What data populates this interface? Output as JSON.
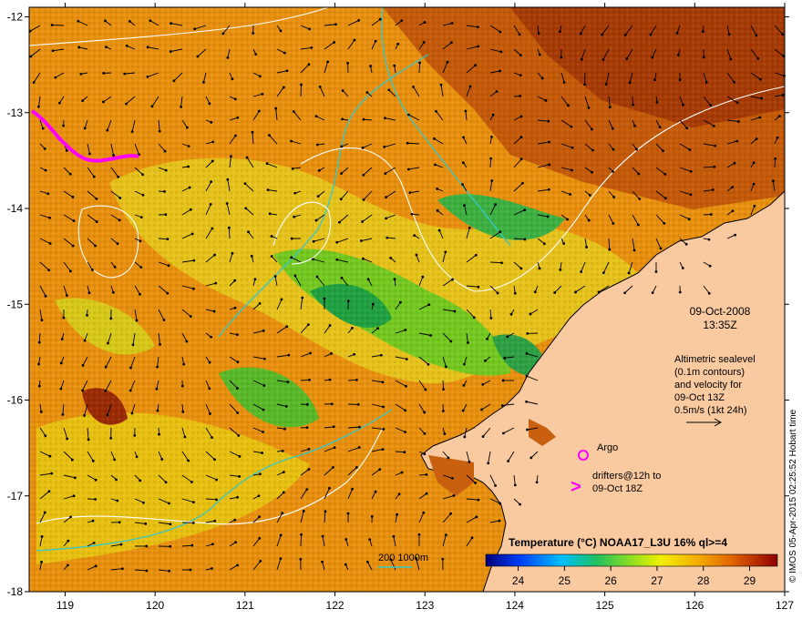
{
  "map": {
    "lon_ticks": [
      "119",
      "120",
      "121",
      "122",
      "123",
      "124",
      "125",
      "126",
      "127"
    ],
    "lat_ticks": [
      "-12",
      "-13",
      "-14",
      "-15",
      "-16",
      "-17",
      "-18"
    ],
    "lon_range": [
      118.6,
      127.0
    ],
    "lat_range": [
      -11.9,
      -18.0
    ]
  },
  "annotations": {
    "date": "09-Oct-2008",
    "time": "13:35Z",
    "alt_line1": "Altimetric sealevel",
    "alt_line2": "(0.1m contours)",
    "alt_line3": "and velocity for",
    "alt_line4": "09-Oct 13Z",
    "alt_line5": "0.5m/s (1kt 24h)",
    "argo_label": "Argo",
    "drifters_line1": "drifters@12h to",
    "drifters_line2": "09-Oct 18Z",
    "drifter_symbol": ">",
    "depth_legend": "200  1000m",
    "credit": "© IMOS 05-Apr-2015 02:25:52 Hobart time"
  },
  "colorbar": {
    "title": "Temperature (°C) NOAA17_L3U 16% ql>=4",
    "ticks": [
      "24",
      "25",
      "26",
      "27",
      "28",
      "29"
    ],
    "range": [
      23.3,
      29.6
    ]
  },
  "colors": {
    "land": "#f9c9a0",
    "argo": "#ff00ff",
    "isobath": "#35c8c8",
    "contour": "#ffffff"
  }
}
